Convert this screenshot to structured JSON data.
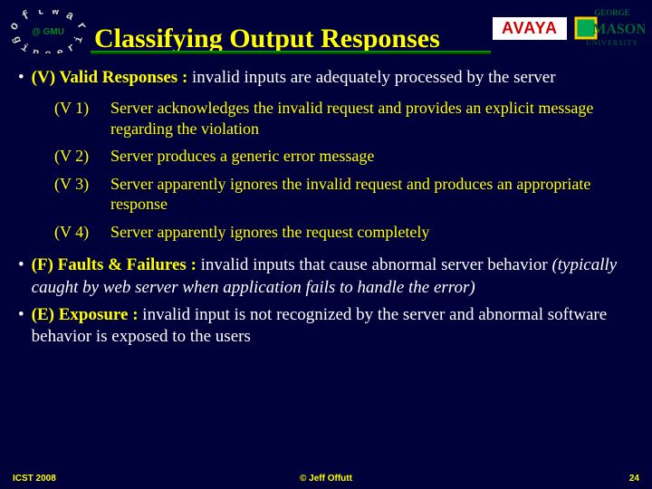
{
  "header": {
    "title": "Classifying Output Responses",
    "logo_left_alt": "Software Engineering @ GMU",
    "avaya": "AVAYA",
    "gmu_top": "GEORGE",
    "gmu_mid": "UNIVERSITY",
    "gmu_name": "MASON"
  },
  "bullets": {
    "v_lead": "(V) Valid Responses :",
    "v_rest": " invalid inputs are adequately processed by the server",
    "f_lead": "(F) Faults & Failures :",
    "f_rest": " invalid inputs that cause abnormal server behavior ",
    "f_italic": "(typically caught by web server when application fails to handle the error)",
    "e_lead": "(E) Exposure :",
    "e_rest": " invalid input is not recognized by the server and abnormal software behavior is exposed to the users"
  },
  "rows": [
    {
      "k": "(V 1)",
      "v": "Server acknowledges the invalid request and provides an explicit message regarding the violation"
    },
    {
      "k": "(V 2)",
      "v": "Server produces a generic error message"
    },
    {
      "k": "(V 3)",
      "v": "Server apparently ignores the invalid request and produces an appropriate response"
    },
    {
      "k": "(V 4)",
      "v": "Server apparently ignores the request completely"
    }
  ],
  "footer": {
    "left": "ICST 2008",
    "mid": "© Jeff Offutt",
    "right": "24"
  }
}
